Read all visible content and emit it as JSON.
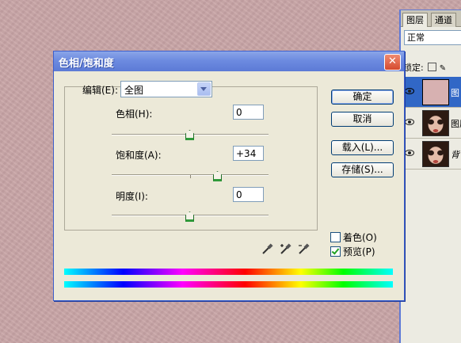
{
  "layers_panel": {
    "tabs": [
      "图层",
      "通道"
    ],
    "blend_mode": "正常",
    "lock_label": "锁定:",
    "layers": [
      {
        "name": "图",
        "thumbnail": "pink-fill",
        "selected": true
      },
      {
        "name": "图层",
        "thumbnail": "portrait",
        "selected": false
      },
      {
        "name": "背",
        "thumbnail": "portrait",
        "selected": false
      }
    ]
  },
  "dialog": {
    "title": "色相/饱和度",
    "close_icon": "close-icon",
    "edit_label": "编辑(E):",
    "edit_value": "全图",
    "hue": {
      "label": "色相(H):",
      "value": "0",
      "slider_fraction": 0.5
    },
    "saturation": {
      "label": "饱和度(A):",
      "value": "+34",
      "slider_fraction": 0.67
    },
    "lightness": {
      "label": "明度(I):",
      "value": "0",
      "slider_fraction": 0.5
    },
    "buttons": {
      "ok": "确定",
      "cancel": "取消",
      "load": "载入(L)...",
      "save": "存储(S)..."
    },
    "colorize": {
      "label": "着色(O)",
      "checked": false
    },
    "preview": {
      "label": "预览(P)",
      "checked": true
    },
    "tools": [
      "eyedropper-icon",
      "eyedropper-plus-icon",
      "eyedropper-minus-icon"
    ],
    "accent_color": "#3d5fcc"
  }
}
